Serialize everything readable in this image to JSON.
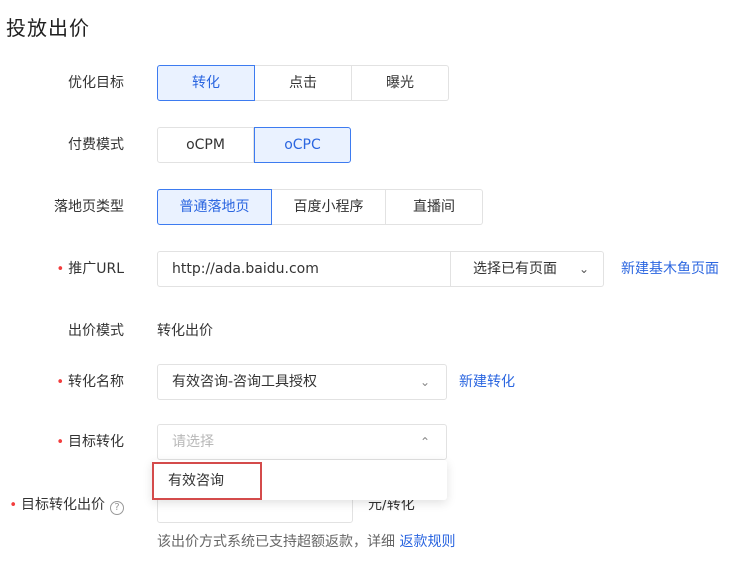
{
  "page": {
    "title": "投放出价"
  },
  "optimization_goal": {
    "label": "优化目标",
    "options": [
      "转化",
      "点击",
      "曝光"
    ],
    "selected": "转化"
  },
  "billing_mode": {
    "label": "付费模式",
    "options": [
      "oCPM",
      "oCPC"
    ],
    "selected": "oCPC"
  },
  "landing_page_type": {
    "label": "落地页类型",
    "options": [
      "普通落地页",
      "百度小程序",
      "直播间"
    ],
    "selected": "普通落地页"
  },
  "promo_url": {
    "required_mark": "•",
    "label": "推广URL",
    "value": "http://ada.baidu.com",
    "select_existing_label": "选择已有页面",
    "new_page_link": "新建基木鱼页面"
  },
  "bid_mode": {
    "label": "出价模式",
    "value": "转化出价"
  },
  "conversion_name": {
    "required_mark": "•",
    "label": "转化名称",
    "value": "有效咨询-咨询工具授权",
    "new_link": "新建转化"
  },
  "target_conversion": {
    "required_mark": "•",
    "label": "目标转化",
    "placeholder": "请选择",
    "options": [
      "有效咨询"
    ]
  },
  "target_bid": {
    "required_mark": "•",
    "label": "目标转化出价",
    "help_icon": "question-circle-icon",
    "value": "",
    "unit": "元/转化",
    "hint": "该出价方式系统已支持超额返款，详细 ",
    "hint_link": "返款规则"
  },
  "colors": {
    "accent": "#2b66e0",
    "active_bg": "#eaf2ff",
    "required": "#f23d3d",
    "highlight_box": "#d44b4b"
  }
}
